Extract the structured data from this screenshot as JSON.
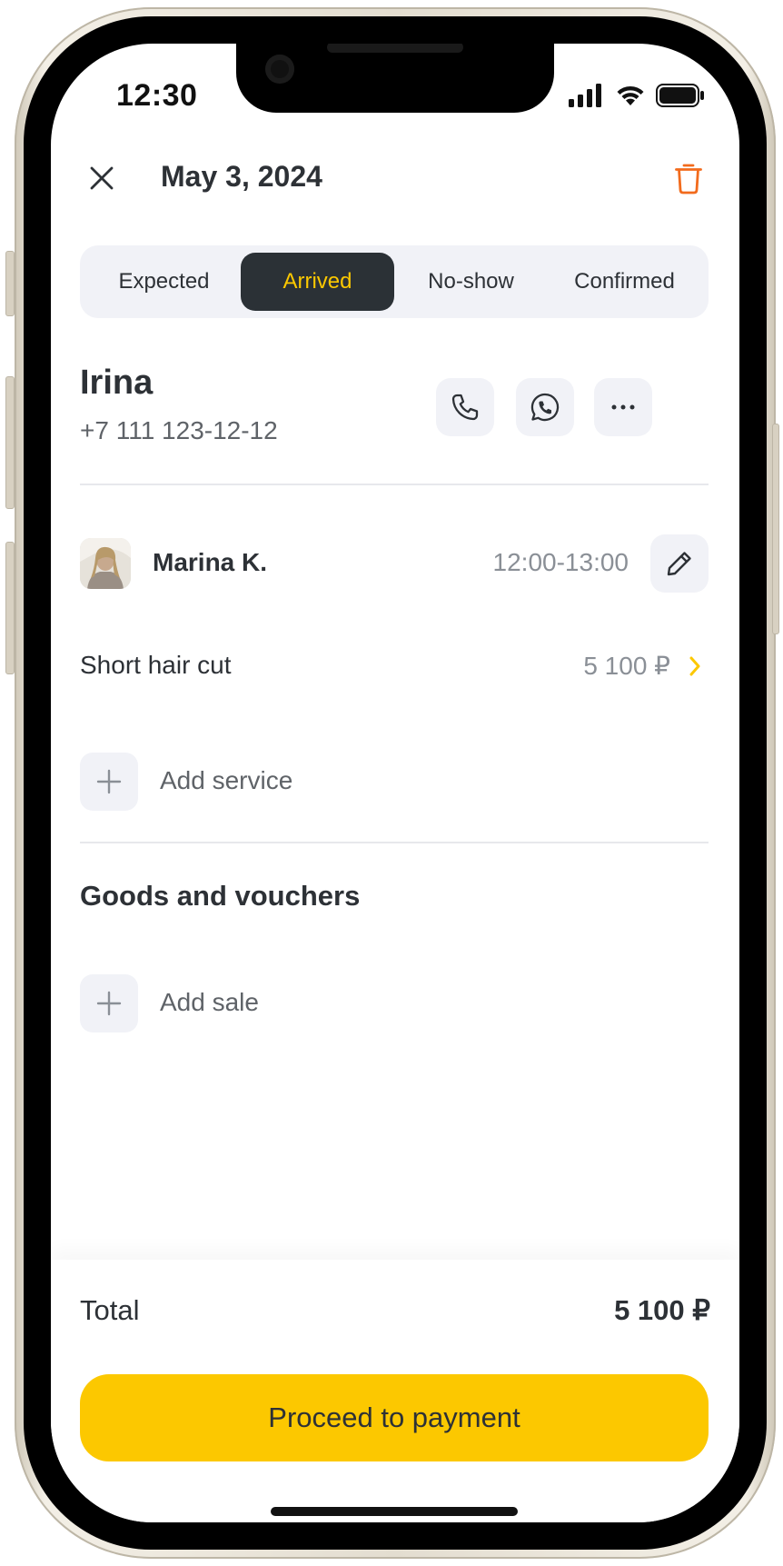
{
  "status_bar": {
    "time": "12:30",
    "signal_icon": "cellular-signal-icon",
    "wifi_icon": "wifi-icon",
    "battery_icon": "battery-icon"
  },
  "header": {
    "title": "May 3, 2024",
    "close_icon": "close-icon",
    "delete_icon": "trash-icon",
    "delete_color": "#f26b1d"
  },
  "status_tabs": {
    "items": [
      "Expected",
      "Arrived",
      "No-show",
      "Confirmed"
    ],
    "selected": "Arrived",
    "active_bg": "#2b3136",
    "active_text": "#fcc800"
  },
  "client": {
    "name": "Irina",
    "phone": "+7 111 123-12-12",
    "actions": [
      "phone-icon",
      "whatsapp-icon",
      "more-icon"
    ]
  },
  "appointment": {
    "master": {
      "name": "Marina K.",
      "time": "12:00-13:00"
    },
    "service": {
      "name": "Short hair cut",
      "price": "5 100 ₽"
    },
    "add_service_label": "Add service"
  },
  "goods": {
    "title": "Goods and vouchers",
    "add_sale_label": "Add sale"
  },
  "footer": {
    "total_label": "Total",
    "total_value": "5 100 ₽",
    "pay_label": "Proceed to payment",
    "pay_color": "#fcc800"
  }
}
